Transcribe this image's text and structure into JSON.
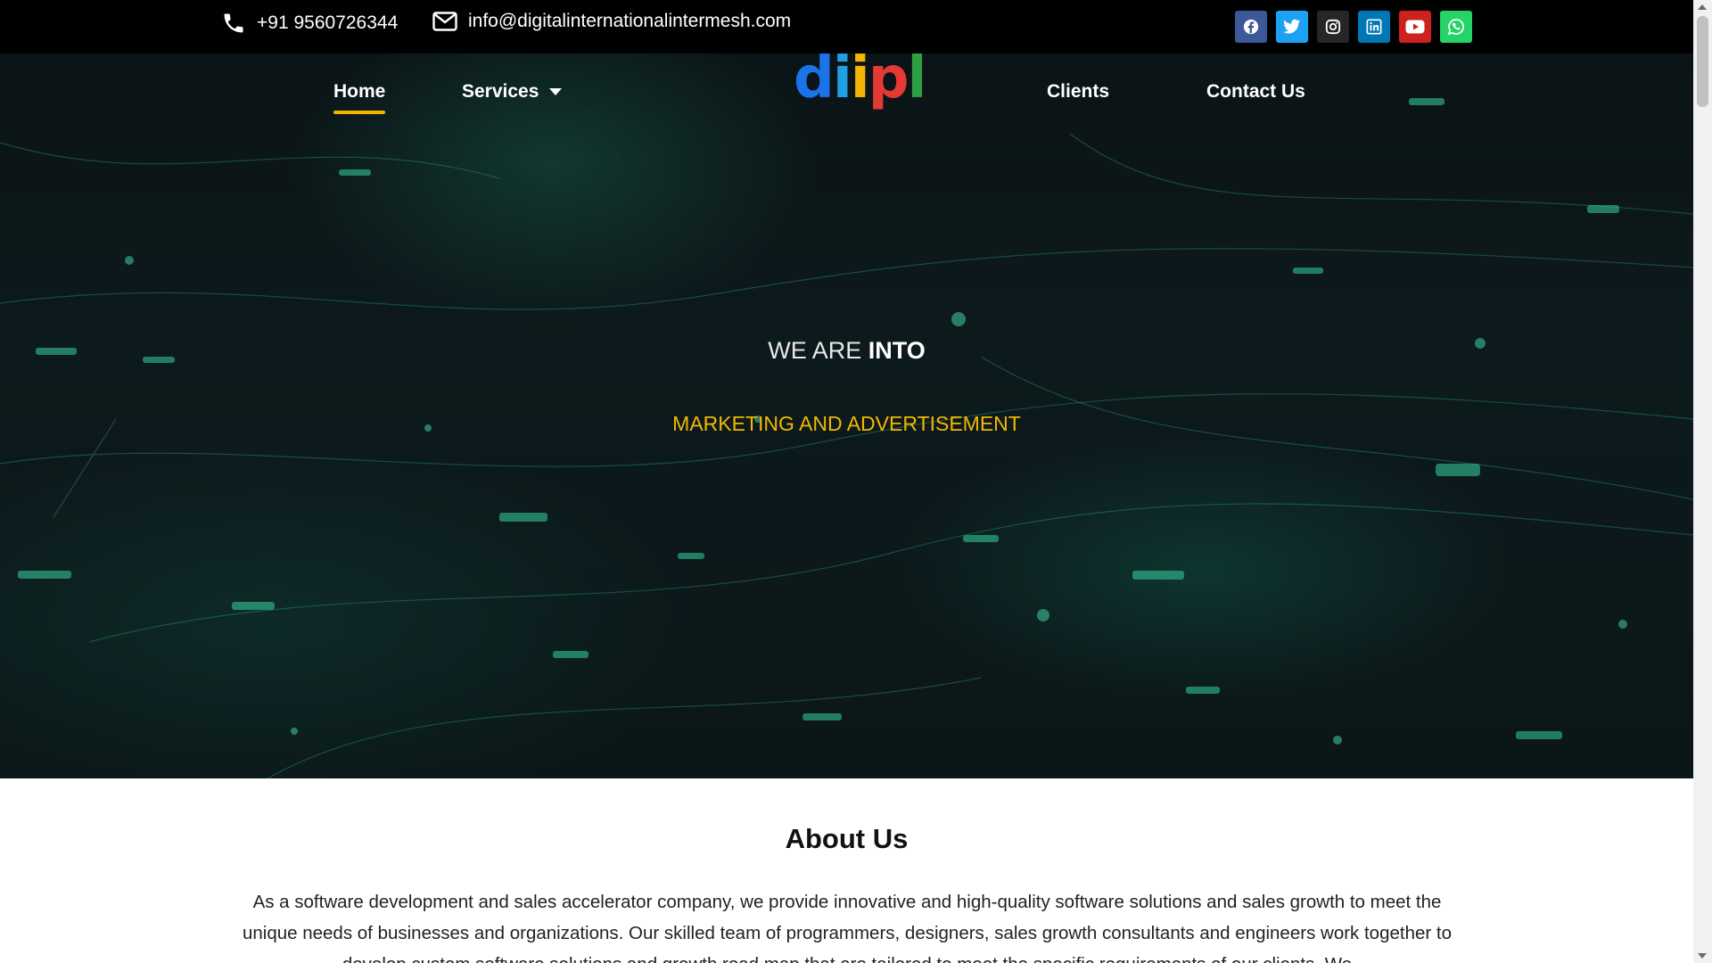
{
  "topbar": {
    "phone": "+91 9560726344",
    "email": "info@digitalinternationalintermesh.com",
    "icons": {
      "phone": "phone-icon",
      "email": "envelope-icon"
    },
    "socials": [
      {
        "name": "facebook",
        "color": "#3b5998"
      },
      {
        "name": "twitter",
        "color": "#1da1f2"
      },
      {
        "name": "instagram",
        "color": "#262626"
      },
      {
        "name": "linkedin",
        "color": "#0077b5"
      },
      {
        "name": "youtube",
        "color": "#cd201f"
      },
      {
        "name": "whatsapp",
        "color": "#25d366"
      }
    ]
  },
  "nav": {
    "home": "Home",
    "services": "Services",
    "clients": "Clients",
    "contact": "Contact Us"
  },
  "logo": {
    "d": "d",
    "i1": "i",
    "i2": "i",
    "p": "p",
    "l": "l"
  },
  "hero": {
    "tagline_light": "WE ARE ",
    "tagline_bold": "INTO",
    "rotating_text": "MARKETING AND ADVERTISEMENT"
  },
  "about": {
    "title": "About Us",
    "text": "As a software development and sales accelerator company, we provide innovative and high-quality software solutions and sales growth to meet the unique needs of businesses and organizations. Our skilled team of programmers, designers, sales growth consultants and engineers work together to develop custom software solutions and growth road map that are tailored to meet the specific requirements of our clients. We"
  },
  "colors": {
    "accent": "#f4b400",
    "topbar": "#000000"
  }
}
